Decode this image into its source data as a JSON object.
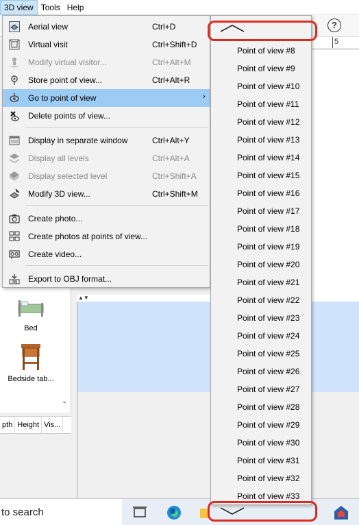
{
  "menubar": {
    "items": [
      {
        "label": "3D view",
        "active": true
      },
      {
        "label": "Tools",
        "active": false
      },
      {
        "label": "Help",
        "active": false
      }
    ]
  },
  "toolbar": {
    "help_label": "?"
  },
  "ruler": {
    "mark": "5"
  },
  "menu": {
    "items": [
      {
        "label": "Aerial view",
        "shortcut": "Ctrl+D",
        "icon": "aerial-view-icon",
        "disabled": false
      },
      {
        "label": "Virtual visit",
        "shortcut": "Ctrl+Shift+D",
        "icon": "virtual-visit-icon",
        "disabled": false
      },
      {
        "label": "Modify virtual visitor...",
        "shortcut": "Ctrl+Alt+M",
        "icon": "visitor-icon",
        "disabled": true
      },
      {
        "label": "Store point of view...",
        "shortcut": "Ctrl+Alt+R",
        "icon": "store-pov-icon",
        "disabled": false
      },
      {
        "label": "Go to point of view",
        "shortcut": "",
        "icon": "goto-pov-icon",
        "disabled": false,
        "submenu": true
      },
      {
        "label": "Delete points of view...",
        "shortcut": "",
        "icon": "delete-pov-icon",
        "disabled": false
      },
      {
        "label": "Display in separate window",
        "shortcut": "Ctrl+Alt+Y",
        "icon": "separate-window-icon",
        "disabled": false
      },
      {
        "label": "Display all levels",
        "shortcut": "Ctrl+Alt+A",
        "icon": "all-levels-icon",
        "disabled": true
      },
      {
        "label": "Display selected level",
        "shortcut": "Ctrl+Shift+A",
        "icon": "selected-level-icon",
        "disabled": true
      },
      {
        "label": "Modify 3D view...",
        "shortcut": "Ctrl+Shift+M",
        "icon": "modify-3d-icon",
        "disabled": false
      },
      {
        "label": "Create photo...",
        "shortcut": "",
        "icon": "photo-icon",
        "disabled": false
      },
      {
        "label": "Create photos at points of view...",
        "shortcut": "",
        "icon": "photos-pov-icon",
        "disabled": false
      },
      {
        "label": "Create video...",
        "shortcut": "",
        "icon": "video-icon",
        "disabled": false
      },
      {
        "label": "Export to OBJ format...",
        "shortcut": "",
        "icon": "export-obj-icon",
        "disabled": false
      }
    ],
    "submenu_arrow": "›"
  },
  "submenu": {
    "items": [
      "Point of view #8",
      "Point of view #9",
      "Point of view #10",
      "Point of view #11",
      "Point of view #12",
      "Point of view #13",
      "Point of view #14",
      "Point of view #15",
      "Point of view #16",
      "Point of view #17",
      "Point of view #18",
      "Point of view #19",
      "Point of view #20",
      "Point of view #21",
      "Point of view #22",
      "Point of view #23",
      "Point of view #24",
      "Point of view #25",
      "Point of view #26",
      "Point of view #27",
      "Point of view #28",
      "Point of view #29",
      "Point of view #30",
      "Point of view #31",
      "Point of view #32",
      "Point of view #33"
    ]
  },
  "furniture": {
    "items": [
      {
        "label": "Bed",
        "icon": "bed-icon"
      },
      {
        "label": "Bedside tab...",
        "icon": "bedside-table-icon"
      }
    ]
  },
  "table_headers": [
    "pth",
    "Height",
    "Vis..."
  ],
  "taskbar": {
    "search_text": "to search"
  },
  "colors": {
    "highlight": "#9ccbf3",
    "annotation_red": "#e02a1f",
    "view_blue": "#cfe3fb"
  }
}
